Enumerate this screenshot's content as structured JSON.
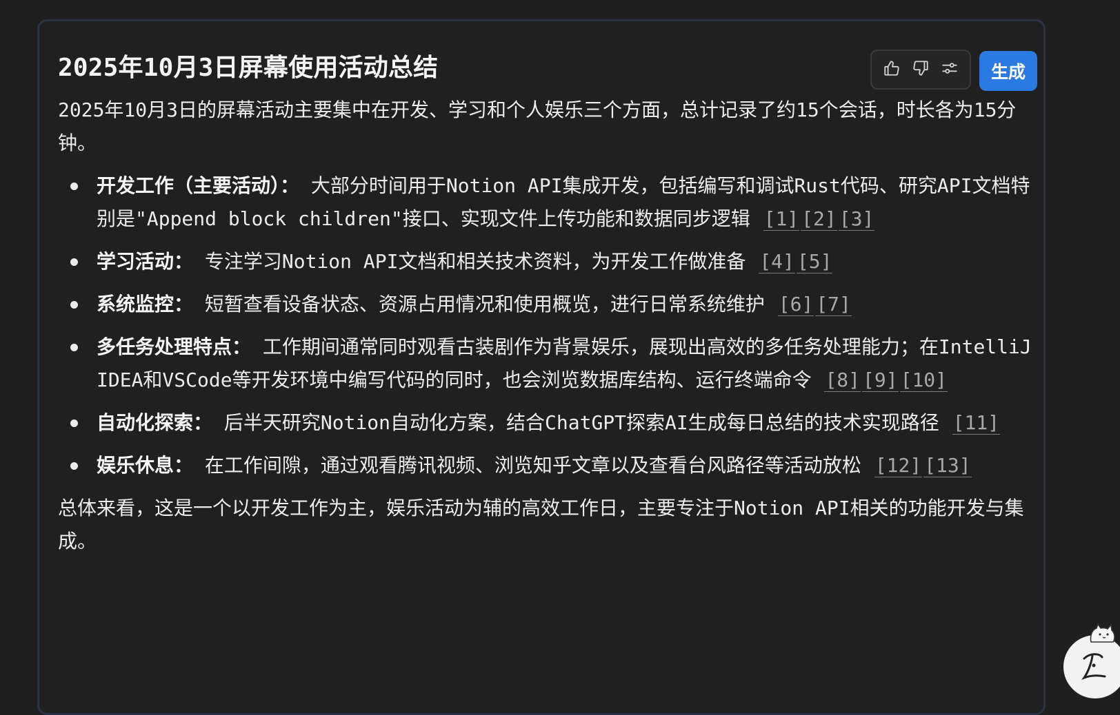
{
  "summary": {
    "title": "2025年10月3日屏幕使用活动总结",
    "intro": "2025年10月3日的屏幕活动主要集中在开发、学习和个人娱乐三个方面，总计记录了约15个会话，时长各为15分钟。",
    "items": [
      {
        "title": "开发工作（主要活动）：",
        "text": " 大部分时间用于Notion API集成开发，包括编写和调试Rust代码、研究API文档特别是\"Append block children\"接口、实现文件上传功能和数据同步逻辑 ",
        "cites": [
          "[1]",
          "[2]",
          "[3]"
        ]
      },
      {
        "title": "学习活动：",
        "text": " 专注学习Notion API文档和相关技术资料，为开发工作做准备 ",
        "cites": [
          "[4]",
          "[5]"
        ]
      },
      {
        "title": "系统监控：",
        "text": " 短暂查看设备状态、资源占用情况和使用概览，进行日常系统维护 ",
        "cites": [
          "[6]",
          "[7]"
        ]
      },
      {
        "title": "多任务处理特点：",
        "text": " 工作期间通常同时观看古装剧作为背景娱乐，展现出高效的多任务处理能力；在IntelliJ IDEA和VSCode等开发环境中编写代码的同时，也会浏览数据库结构、运行终端命令 ",
        "cites": [
          "[8]",
          "[9]",
          "[10]"
        ]
      },
      {
        "title": "自动化探索：",
        "text": " 后半天研究Notion自动化方案，结合ChatGPT探索AI生成每日总结的技术实现路径 ",
        "cites": [
          "[11]"
        ]
      },
      {
        "title": "娱乐休息：",
        "text": " 在工作间隙，通过观看腾讯视频、浏览知乎文章以及查看台风路径等活动放松 ",
        "cites": [
          "[12]",
          "[13]"
        ]
      }
    ],
    "closing": "总体来看，这是一个以开发工作为主，娱乐活动为辅的高效工作日，主要专注于Notion API相关的功能开发与集成。"
  },
  "toolbar": {
    "like_icon": "thumbs-up-icon",
    "dislike_icon": "thumbs-down-icon",
    "settings_icon": "sliders-icon",
    "generate_label": "生成"
  },
  "colors": {
    "background": "#1f1f20",
    "card_border": "#2c3340",
    "accent": "#2a7ae2",
    "citation": "#a9a9ab"
  }
}
